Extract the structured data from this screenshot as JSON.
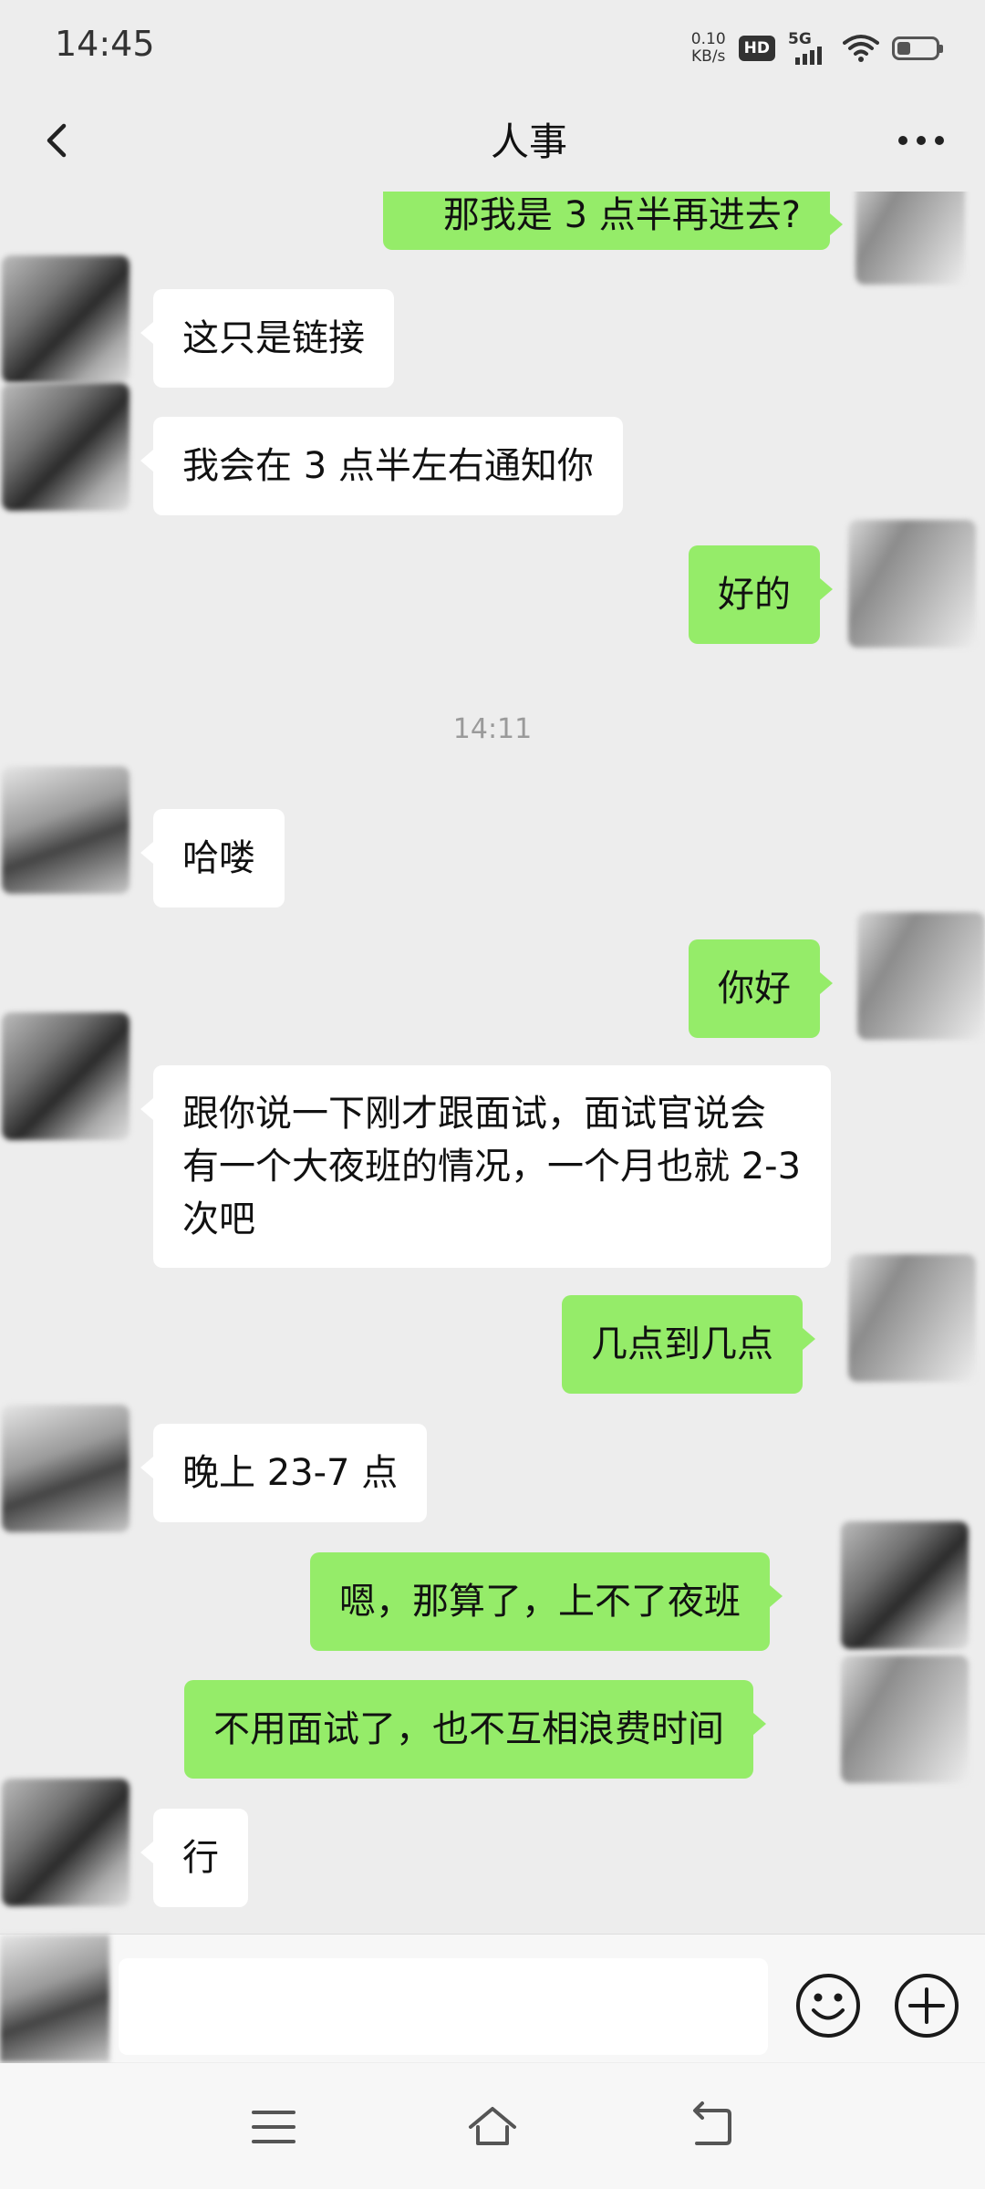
{
  "status_bar": {
    "time": "14:45",
    "net_speed_value": "0.10",
    "net_speed_unit": "KB/s",
    "hd_badge": "HD",
    "network": "5G",
    "battery_level": 0.3
  },
  "header": {
    "title": "人事",
    "back_icon": "chevron-left-icon",
    "more_icon": "more-horizontal-icon"
  },
  "messages": [
    {
      "side": "right",
      "text": "那我是 3 点半再进去?"
    },
    {
      "side": "left",
      "text": "这只是链接"
    },
    {
      "side": "left",
      "text": "我会在 3 点半左右通知你"
    },
    {
      "side": "right",
      "text": "好的"
    },
    {
      "side": "left",
      "text": "哈喽"
    },
    {
      "side": "right",
      "text": "你好"
    },
    {
      "side": "left",
      "text": "跟你说一下刚才跟面试，面试官说会有一个大夜班的情况，一个月也就 2-3 次吧"
    },
    {
      "side": "right",
      "text": "几点到几点"
    },
    {
      "side": "left",
      "text": "晚上 23-7 点"
    },
    {
      "side": "right",
      "text": "嗯，那算了，上不了夜班"
    },
    {
      "side": "right",
      "text": "不用面试了，也不互相浪费时间"
    },
    {
      "side": "left",
      "text": "行"
    }
  ],
  "timestamp": "14:11",
  "input_bar": {
    "placeholder": "",
    "emoji_icon": "smiley-face-icon",
    "plus_icon": "plus-circle-icon"
  },
  "nav_bar": {
    "icons": [
      "menu-icon",
      "home-icon",
      "back-arrow-icon"
    ]
  },
  "colors": {
    "background": "#ededed",
    "outgoing_bubble": "#95ec69",
    "incoming_bubble": "#ffffff"
  }
}
